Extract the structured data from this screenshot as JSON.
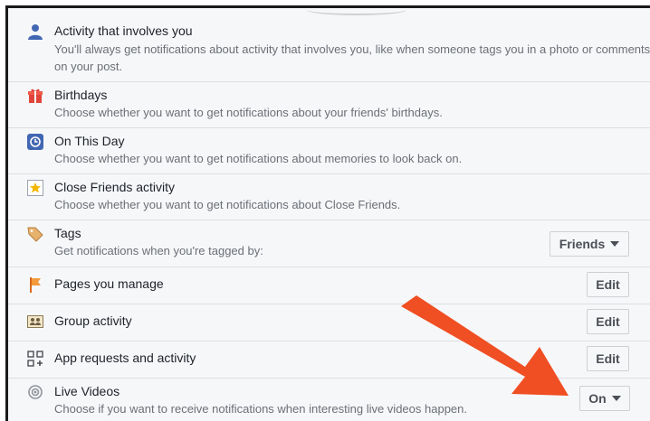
{
  "settings": [
    {
      "title": "Activity that involves you",
      "desc": "You'll always get notifications about activity that involves you, like when someone tags you in a photo or comments on your post.",
      "icon": "person-icon"
    },
    {
      "title": "Birthdays",
      "desc": "Choose whether you want to get notifications about your friends' birthdays.",
      "icon": "gift-icon"
    },
    {
      "title": "On This Day",
      "desc": "Choose whether you want to get notifications about memories to look back on.",
      "icon": "clock-history-icon"
    },
    {
      "title": "Close Friends activity",
      "desc": "Choose whether you want to get notifications about Close Friends.",
      "icon": "star-icon"
    },
    {
      "title": "Tags",
      "desc": "Get notifications when you're tagged by:",
      "icon": "tag-icon",
      "button": "Friends",
      "dropdown": true
    },
    {
      "title": "Pages you manage",
      "icon": "flag-icon",
      "button": "Edit"
    },
    {
      "title": "Group activity",
      "icon": "group-icon",
      "button": "Edit"
    },
    {
      "title": "App requests and activity",
      "icon": "app-icon",
      "button": "Edit"
    },
    {
      "title": "Live Videos",
      "desc": "Choose if you want to receive notifications when interesting live videos happen.",
      "icon": "live-icon",
      "button": "On",
      "dropdown": true
    }
  ],
  "colors": {
    "accent": "#4267b2",
    "annotation_arrow": "#f04e23"
  }
}
